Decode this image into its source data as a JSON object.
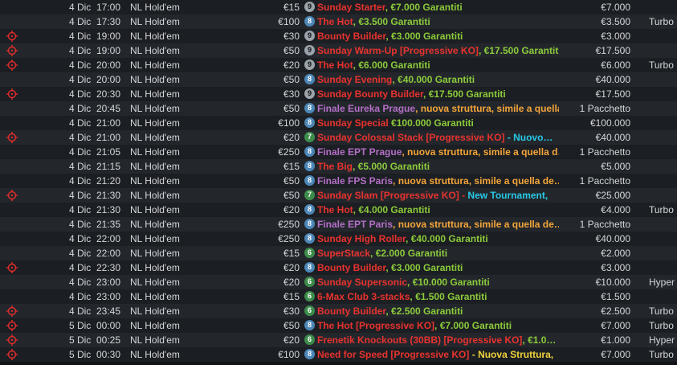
{
  "colors": {
    "red": "#e8332f",
    "green": "#8ccb3b",
    "purple": "#b46fc7",
    "orange": "#f4a53a",
    "cyan": "#27c9e7",
    "yellow": "#f0d23a",
    "target_icon": "#d72d2d"
  },
  "tournaments": [
    {
      "icon": "",
      "date": "4 Dic",
      "time": "17:00",
      "game": "NL Hold'em",
      "buyin": "€15",
      "seats": "9",
      "seat_color": "white",
      "name": [
        {
          "t": "Sunday Starter",
          "c": "red"
        },
        {
          "t": ", ",
          "c": "green"
        },
        {
          "t": "€7.000 Garantiti",
          "c": "green"
        }
      ],
      "prize": "€7.000",
      "speed": ""
    },
    {
      "icon": "",
      "date": "4 Dic",
      "time": "17:30",
      "game": "NL Hold'em",
      "buyin": "€100",
      "seats": "8",
      "seat_color": "blue",
      "name": [
        {
          "t": "The Hot",
          "c": "red"
        },
        {
          "t": ", ",
          "c": "green"
        },
        {
          "t": "€3.500 Garantiti",
          "c": "green"
        }
      ],
      "prize": "€3.500",
      "speed": "Turbo"
    },
    {
      "icon": "target-icon",
      "date": "4 Dic",
      "time": "19:00",
      "game": "NL Hold'em",
      "buyin": "€30",
      "seats": "9",
      "seat_color": "white",
      "name": [
        {
          "t": "Bounty Builder",
          "c": "red"
        },
        {
          "t": ", ",
          "c": "green"
        },
        {
          "t": "€3.000 Garantiti",
          "c": "green"
        }
      ],
      "prize": "€3.000",
      "speed": ""
    },
    {
      "icon": "target-icon",
      "date": "4 Dic",
      "time": "19:00",
      "game": "NL Hold'em",
      "buyin": "€50",
      "seats": "9",
      "seat_color": "white",
      "name": [
        {
          "t": "Sunday Warm-Up [Progressive KO]",
          "c": "red"
        },
        {
          "t": ", ",
          "c": "green"
        },
        {
          "t": "€17.500 Garantiti",
          "c": "green"
        }
      ],
      "prize": "€17.500",
      "speed": ""
    },
    {
      "icon": "target-icon",
      "date": "4 Dic",
      "time": "20:00",
      "game": "NL Hold'em",
      "buyin": "€20",
      "seats": "9",
      "seat_color": "white",
      "name": [
        {
          "t": "The Hot",
          "c": "red"
        },
        {
          "t": ", ",
          "c": "green"
        },
        {
          "t": "€6.000 Garantiti",
          "c": "green"
        }
      ],
      "prize": "€6.000",
      "speed": "Turbo"
    },
    {
      "icon": "",
      "date": "4 Dic",
      "time": "20:00",
      "game": "NL Hold'em",
      "buyin": "€50",
      "seats": "8",
      "seat_color": "blue",
      "name": [
        {
          "t": "Sunday Evening",
          "c": "red"
        },
        {
          "t": ", ",
          "c": "green"
        },
        {
          "t": "€40.000 Garantiti",
          "c": "green"
        }
      ],
      "prize": "€40.000",
      "speed": ""
    },
    {
      "icon": "target-icon",
      "date": "4 Dic",
      "time": "20:30",
      "game": "NL Hold'em",
      "buyin": "€30",
      "seats": "9",
      "seat_color": "white",
      "name": [
        {
          "t": "Sunday Bounty Builder",
          "c": "red"
        },
        {
          "t": ", ",
          "c": "green"
        },
        {
          "t": "€17.500 Garantiti",
          "c": "green"
        }
      ],
      "prize": "€17.500",
      "speed": ""
    },
    {
      "icon": "",
      "date": "4 Dic",
      "time": "20:45",
      "game": "NL Hold'em",
      "buyin": "€50",
      "seats": "8",
      "seat_color": "blue",
      "name": [
        {
          "t": "Finale Eureka Prague",
          "c": "purple"
        },
        {
          "t": ", ",
          "c": "orange"
        },
        {
          "t": "nuova struttura, simile a quella…",
          "c": "orange"
        }
      ],
      "prize": "1 Pacchetto",
      "speed": ""
    },
    {
      "icon": "",
      "date": "4 Dic",
      "time": "21:00",
      "game": "NL Hold'em",
      "buyin": "€100",
      "seats": "8",
      "seat_color": "blue",
      "name": [
        {
          "t": "Sunday Special",
          "c": "red"
        },
        {
          "t": " ",
          "c": "green"
        },
        {
          "t": "€100.000 Garantiti",
          "c": "green"
        }
      ],
      "prize": "€100.000",
      "speed": ""
    },
    {
      "icon": "target-icon",
      "date": "4 Dic",
      "time": "21:00",
      "game": "NL Hold'em",
      "buyin": "€20",
      "seats": "7",
      "seat_color": "green",
      "name": [
        {
          "t": "Sunday Colossal Stack [Progressive KO]",
          "c": "red"
        },
        {
          "t": " - ",
          "c": "cyan"
        },
        {
          "t": "Nuovo…",
          "c": "cyan"
        }
      ],
      "prize": "€40.000",
      "speed": ""
    },
    {
      "icon": "",
      "date": "4 Dic",
      "time": "21:05",
      "game": "NL Hold'em",
      "buyin": "€250",
      "seats": "8",
      "seat_color": "blue",
      "name": [
        {
          "t": "Finale EPT Prague",
          "c": "purple"
        },
        {
          "t": ", ",
          "c": "orange"
        },
        {
          "t": "nuova struttura, simile a quella d…",
          "c": "orange"
        }
      ],
      "prize": "1 Pacchetto",
      "speed": ""
    },
    {
      "icon": "",
      "date": "4 Dic",
      "time": "21:15",
      "game": "NL Hold'em",
      "buyin": "€15",
      "seats": "8",
      "seat_color": "blue",
      "name": [
        {
          "t": "The Big",
          "c": "red"
        },
        {
          "t": ", ",
          "c": "green"
        },
        {
          "t": "€5.000 Garantiti",
          "c": "green"
        }
      ],
      "prize": "€5.000",
      "speed": ""
    },
    {
      "icon": "",
      "date": "4 Dic",
      "time": "21:20",
      "game": "NL Hold'em",
      "buyin": "€50",
      "seats": "8",
      "seat_color": "blue",
      "name": [
        {
          "t": "Finale FPS Paris",
          "c": "purple"
        },
        {
          "t": ", ",
          "c": "orange"
        },
        {
          "t": "nuova struttura, simile a quella de…",
          "c": "orange"
        }
      ],
      "prize": "1 Pacchetto",
      "speed": ""
    },
    {
      "icon": "target-icon",
      "date": "4 Dic",
      "time": "21:30",
      "game": "NL Hold'em",
      "buyin": "€50",
      "seats": "7",
      "seat_color": "green",
      "name": [
        {
          "t": "Sunday Slam [Progressive KO]",
          "c": "red"
        },
        {
          "t": " - ",
          "c": "red"
        },
        {
          "t": "New Tournament",
          "c": "cyan"
        },
        {
          "t": ",",
          "c": "cyan"
        }
      ],
      "prize": "€25.000",
      "speed": ""
    },
    {
      "icon": "",
      "date": "4 Dic",
      "time": "21:30",
      "game": "NL Hold'em",
      "buyin": "€20",
      "seats": "8",
      "seat_color": "blue",
      "name": [
        {
          "t": "The Hot",
          "c": "red"
        },
        {
          "t": ", ",
          "c": "green"
        },
        {
          "t": "€4.000 Garantiti",
          "c": "green"
        }
      ],
      "prize": "€4.000",
      "speed": "Turbo"
    },
    {
      "icon": "",
      "date": "4 Dic",
      "time": "21:35",
      "game": "NL Hold'em",
      "buyin": "€250",
      "seats": "8",
      "seat_color": "blue",
      "name": [
        {
          "t": "Finale EPT Paris",
          "c": "purple"
        },
        {
          "t": ", ",
          "c": "orange"
        },
        {
          "t": "nuova struttura, simile a quella de…",
          "c": "orange"
        }
      ],
      "prize": "1 Pacchetto",
      "speed": ""
    },
    {
      "icon": "",
      "date": "4 Dic",
      "time": "22:00",
      "game": "NL Hold'em",
      "buyin": "€250",
      "seats": "8",
      "seat_color": "blue",
      "name": [
        {
          "t": "Sunday High Roller",
          "c": "red"
        },
        {
          "t": ", ",
          "c": "green"
        },
        {
          "t": "€40.000 Garantiti",
          "c": "green"
        }
      ],
      "prize": "€40.000",
      "speed": ""
    },
    {
      "icon": "",
      "date": "4 Dic",
      "time": "22:00",
      "game": "NL Hold'em",
      "buyin": "€15",
      "seats": "6",
      "seat_color": "green",
      "name": [
        {
          "t": "SuperStack",
          "c": "red"
        },
        {
          "t": ", ",
          "c": "green"
        },
        {
          "t": "€2.000 Garantiti",
          "c": "green"
        }
      ],
      "prize": "€2.000",
      "speed": ""
    },
    {
      "icon": "target-icon",
      "date": "4 Dic",
      "time": "22:30",
      "game": "NL Hold'em",
      "buyin": "€20",
      "seats": "8",
      "seat_color": "blue",
      "name": [
        {
          "t": "Bounty Builder",
          "c": "red"
        },
        {
          "t": ", ",
          "c": "green"
        },
        {
          "t": "€3.000 Garantiti",
          "c": "green"
        }
      ],
      "prize": "€3.000",
      "speed": ""
    },
    {
      "icon": "",
      "date": "4 Dic",
      "time": "23:00",
      "game": "NL Hold'em",
      "buyin": "€20",
      "seats": "6",
      "seat_color": "green",
      "name": [
        {
          "t": "Sunday Supersonic",
          "c": "red"
        },
        {
          "t": ", ",
          "c": "green"
        },
        {
          "t": "€10.000 Garantiti",
          "c": "green"
        }
      ],
      "prize": "€10.000",
      "speed": "Hyper"
    },
    {
      "icon": "",
      "date": "4 Dic",
      "time": "23:00",
      "game": "NL Hold'em",
      "buyin": "€15",
      "seats": "6",
      "seat_color": "green",
      "name": [
        {
          "t": "6-Max Club 3-stacks",
          "c": "red"
        },
        {
          "t": ", ",
          "c": "green"
        },
        {
          "t": "€1.500 Garantiti",
          "c": "green"
        }
      ],
      "prize": "€1.500",
      "speed": ""
    },
    {
      "icon": "target-icon",
      "date": "4 Dic",
      "time": "23:45",
      "game": "NL Hold'em",
      "buyin": "€30",
      "seats": "6",
      "seat_color": "green",
      "name": [
        {
          "t": "Bounty Builder",
          "c": "red"
        },
        {
          "t": ", ",
          "c": "green"
        },
        {
          "t": "€2.500 Garantiti",
          "c": "green"
        }
      ],
      "prize": "€2.500",
      "speed": "Turbo"
    },
    {
      "icon": "target-icon",
      "date": "5 Dic",
      "time": "00:00",
      "game": "NL Hold'em",
      "buyin": "€50",
      "seats": "8",
      "seat_color": "blue",
      "name": [
        {
          "t": "The Hot [Progressive KO]",
          "c": "red"
        },
        {
          "t": ", ",
          "c": "green"
        },
        {
          "t": "€7.000 Garantiti",
          "c": "green"
        }
      ],
      "prize": "€7.000",
      "speed": "Turbo"
    },
    {
      "icon": "target-icon",
      "date": "5 Dic",
      "time": "00:25",
      "game": "NL Hold'em",
      "buyin": "€20",
      "seats": "6",
      "seat_color": "green",
      "name": [
        {
          "t": "Frenetik Knockouts (30BB) [Progressive KO]",
          "c": "red"
        },
        {
          "t": ", ",
          "c": "green"
        },
        {
          "t": "€1.0…",
          "c": "green"
        }
      ],
      "prize": "€1.000",
      "speed": "Hyper"
    },
    {
      "icon": "target-icon",
      "date": "5 Dic",
      "time": "00:30",
      "game": "NL Hold'em",
      "buyin": "€100",
      "seats": "8",
      "seat_color": "blue",
      "name": [
        {
          "t": "Need for Speed [Progressive KO]",
          "c": "red"
        },
        {
          "t": " - ",
          "c": "yellow"
        },
        {
          "t": "Nuova Struttura",
          "c": "yellow"
        },
        {
          "t": ",",
          "c": "yellow"
        }
      ],
      "prize": "€7.000",
      "speed": "Turbo"
    }
  ]
}
